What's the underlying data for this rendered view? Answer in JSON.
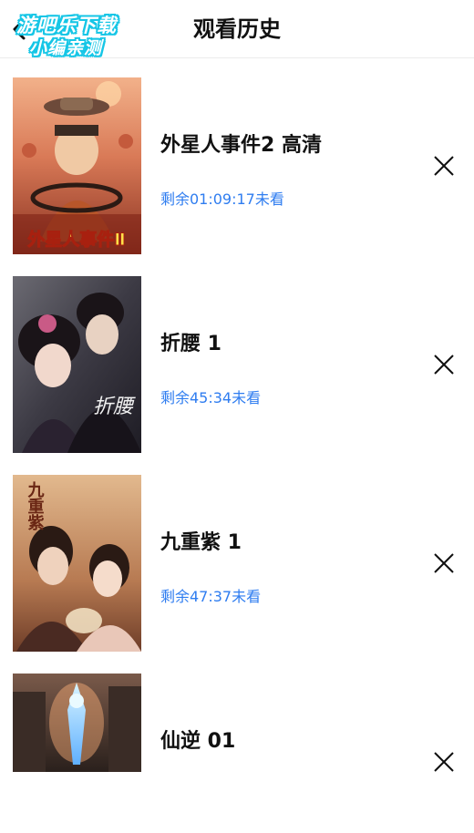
{
  "header": {
    "title": "观看历史",
    "back_icon": "chevron-left-icon"
  },
  "watermark": {
    "line1": "游吧乐下载",
    "line2": "小编亲测"
  },
  "history": [
    {
      "title": "外星人事件2 高清",
      "remaining": "剩余01:09:17未看",
      "poster_caption": "外星人事件Ⅱ"
    },
    {
      "title": "折腰 1",
      "remaining": "剩余45:34未看",
      "poster_caption": "折腰"
    },
    {
      "title": "九重紫 1",
      "remaining": "剩余47:37未看",
      "poster_caption": "九重紫"
    },
    {
      "title": "仙逆 01",
      "remaining": "",
      "poster_caption": ""
    }
  ],
  "colors": {
    "accent": "#2f7df0",
    "watermark": "#16c6e6"
  },
  "icons": {
    "delete": "close-icon"
  }
}
